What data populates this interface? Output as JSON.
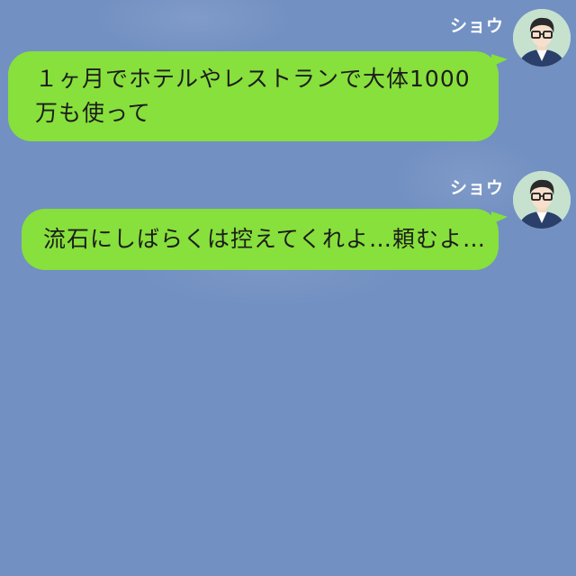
{
  "chat": {
    "background_color": "#7290c2",
    "bubble_color": "#87e03b",
    "messages": [
      {
        "sender": "ショウ",
        "avatar_icon": "man-with-glasses-avatar-icon",
        "text": "１ヶ月でホテルやレストランで大体1000万も使って"
      },
      {
        "sender": "ショウ",
        "avatar_icon": "man-with-glasses-avatar-icon",
        "text": "流石にしばらくは控えてくれよ…頼むよ…"
      }
    ]
  }
}
